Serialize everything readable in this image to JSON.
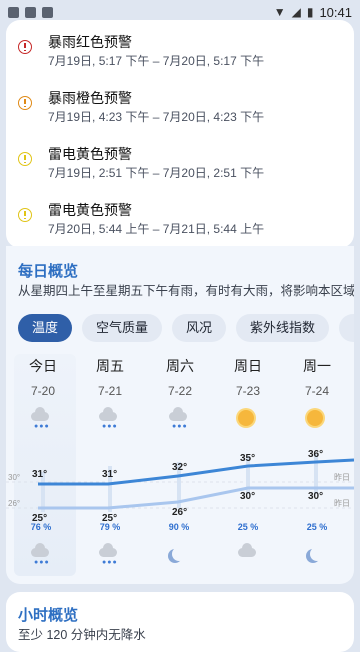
{
  "status_bar": {
    "time": "10:41"
  },
  "alerts": [
    {
      "title": "暴雨红色预警",
      "time": "7月19日, 5:17 下午 – 7月20日, 5:17 下午",
      "color": "#c62828"
    },
    {
      "title": "暴雨橙色预警",
      "time": "7月19日, 4:23 下午 – 7月20日, 4:23 下午",
      "color": "#e08a16"
    },
    {
      "title": "雷电黄色预警",
      "time": "7月19日, 2:51 下午 – 7月20日, 2:51 下午",
      "color": "#e0c416"
    },
    {
      "title": "雷电黄色预警",
      "time": "7月20日, 5:44 上午 – 7月21日, 5:44 上午",
      "color": "#e0c416"
    }
  ],
  "daily": {
    "title": "每日概览",
    "description": "从星期四上午至星期五下午有雨，有时有大雨，将影响本区域",
    "chips": [
      "温度",
      "空气质量",
      "风况",
      "紫外线指数",
      "降水"
    ],
    "days": [
      {
        "name": "今日",
        "date": "7-20",
        "day_icon": "rain-cloud-icon",
        "night_icon": "rain-cloud-icon",
        "high": "31°",
        "low": "25°",
        "precip": "76 %"
      },
      {
        "name": "周五",
        "date": "7-21",
        "day_icon": "rain-cloud-icon",
        "night_icon": "rain-cloud-icon",
        "high": "31°",
        "low": "25°",
        "precip": "79 %"
      },
      {
        "name": "周六",
        "date": "7-22",
        "day_icon": "rain-cloud-icon",
        "night_icon": "moon-icon",
        "high": "32°",
        "low": "26°",
        "precip": "90 %"
      },
      {
        "name": "周日",
        "date": "7-23",
        "day_icon": "sun-icon",
        "night_icon": "cloud-icon",
        "high": "35°",
        "low": "30°",
        "precip": "25 %"
      },
      {
        "name": "周一",
        "date": "7-24",
        "day_icon": "sun-icon",
        "night_icon": "moon-icon",
        "high": "36°",
        "low": "30°",
        "precip": "25 %"
      }
    ],
    "axis": {
      "upper": "30°",
      "lower": "26°",
      "yesterday": "昨日"
    }
  },
  "hourly": {
    "title": "小时概览",
    "subtitle": "至少 120 分钟内无降水"
  }
}
